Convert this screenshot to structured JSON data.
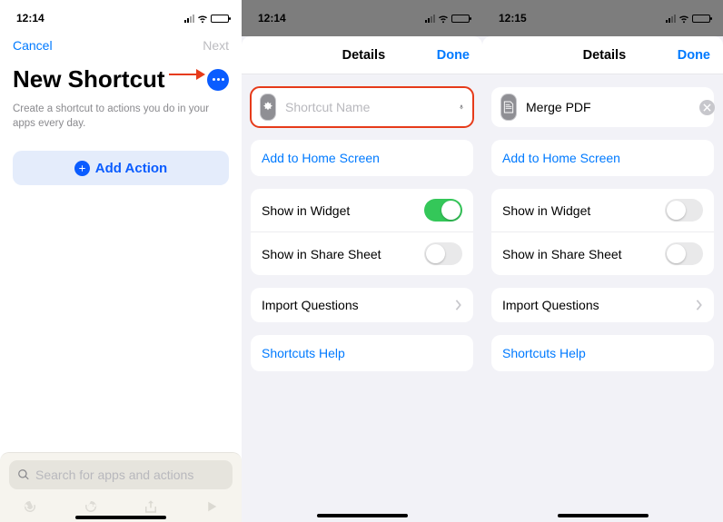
{
  "panel1": {
    "time": "12:14",
    "cancel": "Cancel",
    "next": "Next",
    "title": "New Shortcut",
    "subtitle": "Create a shortcut to actions you do in your apps every day.",
    "add_action": "Add Action",
    "search_placeholder": "Search for apps and actions"
  },
  "panel2": {
    "time": "12:14",
    "header": "Details",
    "done": "Done",
    "name_value": "",
    "name_placeholder": "Shortcut Name",
    "add_home": "Add to Home Screen",
    "show_widget": "Show in Widget",
    "show_widget_on": true,
    "show_share": "Show in Share Sheet",
    "show_share_on": false,
    "import_q": "Import Questions",
    "help": "Shortcuts Help"
  },
  "panel3": {
    "time": "12:15",
    "header": "Details",
    "done": "Done",
    "name_value": "Merge PDF",
    "add_home": "Add to Home Screen",
    "show_widget": "Show in Widget",
    "show_widget_on": false,
    "show_share": "Show in Share Sheet",
    "show_share_on": false,
    "import_q": "Import Questions",
    "help": "Shortcuts Help"
  }
}
